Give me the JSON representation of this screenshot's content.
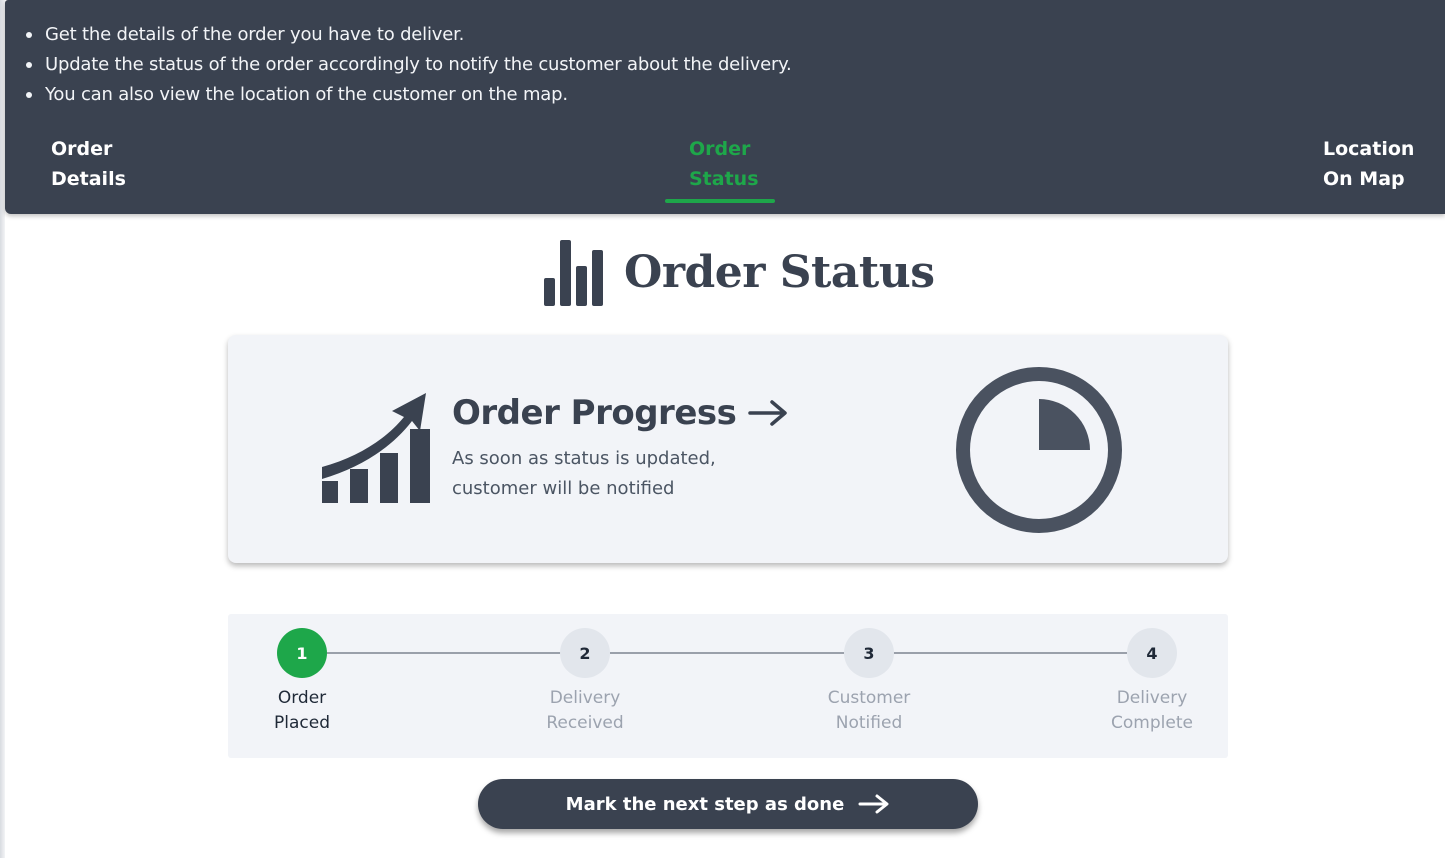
{
  "instructions": [
    "Get the details of the order you have to deliver.",
    "Update the status of the order accordingly to notify the customer about the delivery.",
    "You can also view the location of the customer on the map."
  ],
  "tabs": {
    "order_details": {
      "line1": "Order",
      "line2": "Details"
    },
    "order_status": {
      "line1": "Order",
      "line2": "Status",
      "active": true
    },
    "location_on_map": {
      "line1": "Location",
      "line2": "On Map"
    }
  },
  "page": {
    "title": "Order Status",
    "title_icon": "bar-chart-icon"
  },
  "progress_card": {
    "title": "Order Progress",
    "description_line1": "As soon as status is updated,",
    "description_line2": "customer will be notified",
    "left_icon": "growth-chart-icon",
    "right_icon": "clock-quarter-icon",
    "heading_icon": "arrow-right-icon"
  },
  "stepper": {
    "steps": [
      {
        "number": "1",
        "line1": "Order",
        "line2": "Placed",
        "done": true
      },
      {
        "number": "2",
        "line1": "Delivery",
        "line2": "Received",
        "done": false
      },
      {
        "number": "3",
        "line1": "Customer",
        "line2": "Notified",
        "done": false
      },
      {
        "number": "4",
        "line1": "Delivery",
        "line2": "Complete",
        "done": false
      }
    ]
  },
  "action": {
    "label": "Mark the next step as done",
    "icon": "arrow-right-icon"
  },
  "colors": {
    "primary": "#3a4250",
    "accent": "#1ea74a",
    "card_bg": "#f2f4f8"
  }
}
